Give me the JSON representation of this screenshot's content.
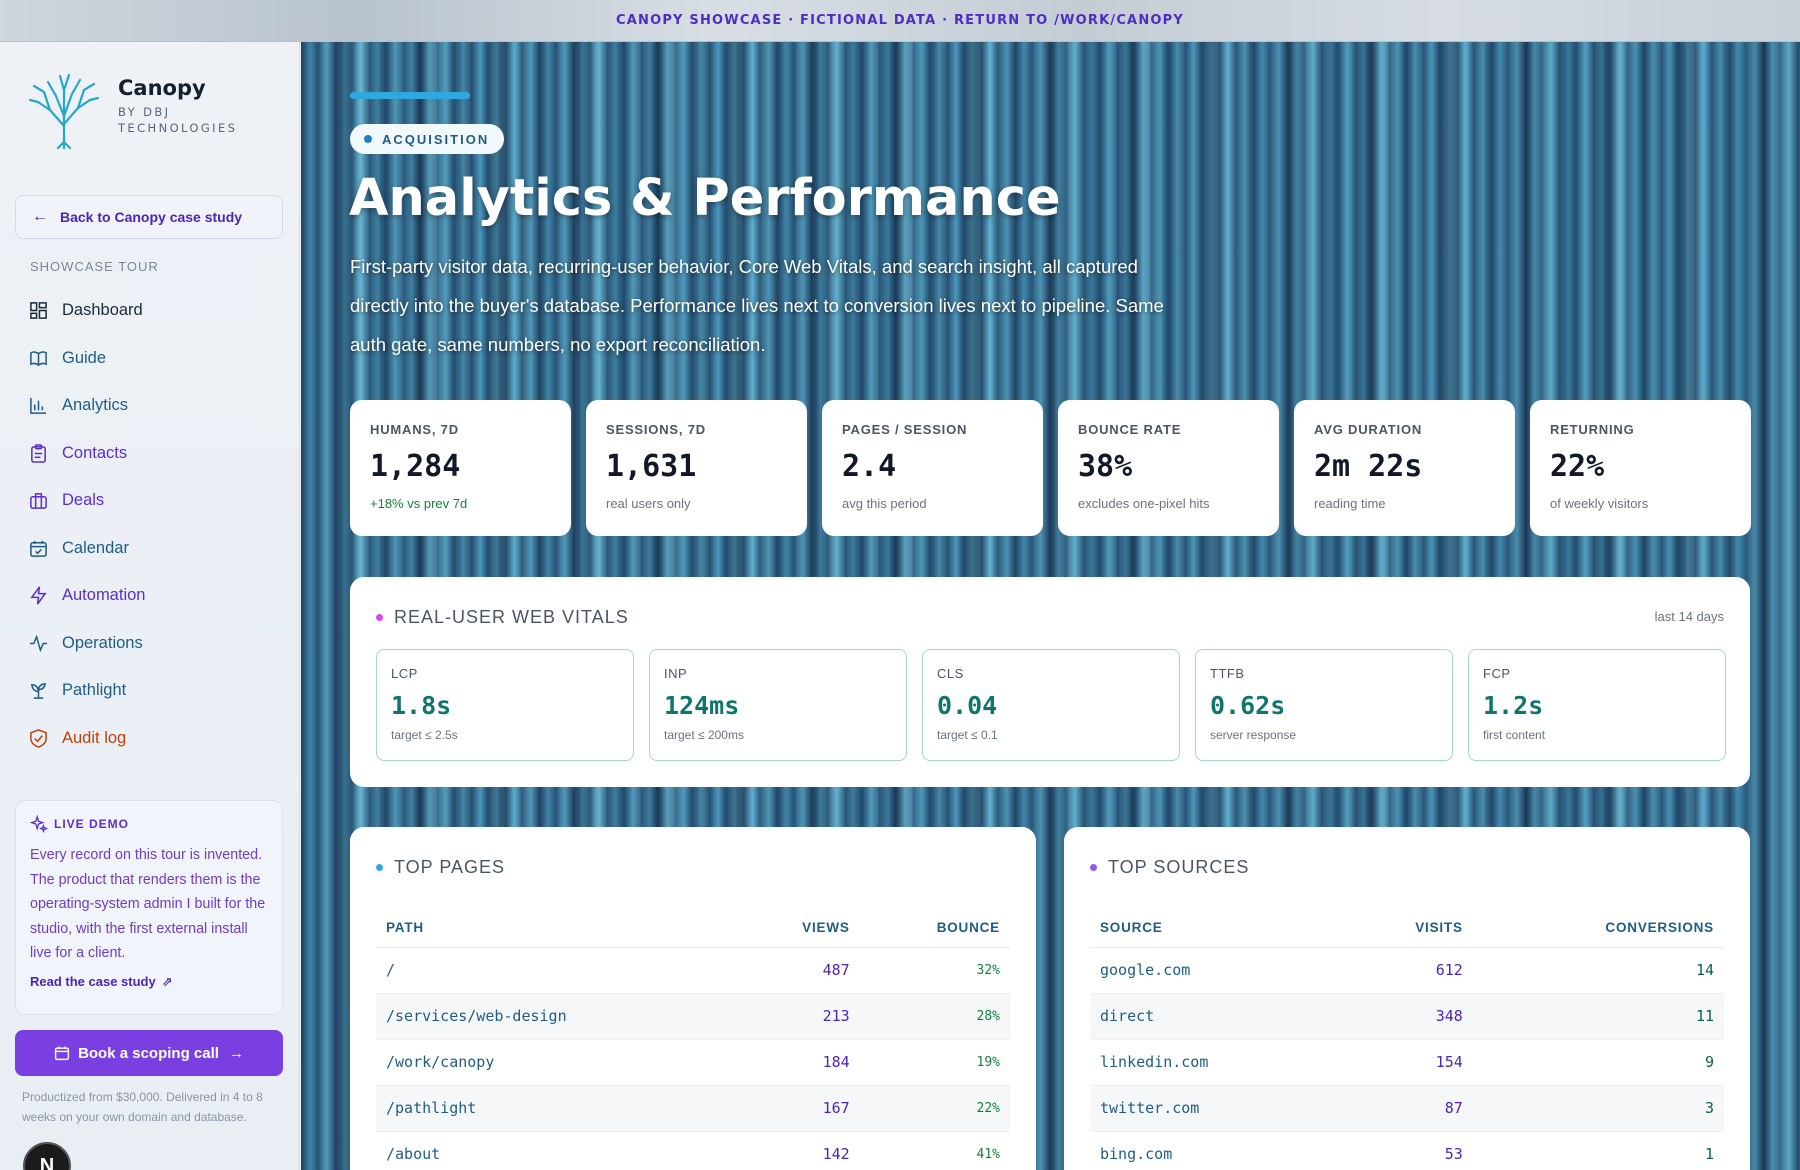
{
  "banner": {
    "text": "CANOPY SHOWCASE · FICTIONAL DATA · RETURN TO /WORK/CANOPY"
  },
  "brand": {
    "name": "Canopy",
    "sub": "BY DBJ TECHNOLOGIES"
  },
  "back": {
    "label": "Back to Canopy case study"
  },
  "tour": {
    "label": "SHOWCASE TOUR"
  },
  "nav": [
    {
      "label": "Dashboard",
      "icon": "dashboard-icon",
      "color": "#1f2a37"
    },
    {
      "label": "Guide",
      "icon": "book-icon",
      "color": "#1f5d86"
    },
    {
      "label": "Analytics",
      "icon": "bar-chart-icon",
      "color": "#1f5d86"
    },
    {
      "label": "Contacts",
      "icon": "clipboard-icon",
      "color": "#5b2fc9"
    },
    {
      "label": "Deals",
      "icon": "briefcase-icon",
      "color": "#5b2fc9"
    },
    {
      "label": "Calendar",
      "icon": "calendar-icon",
      "color": "#1f5d86"
    },
    {
      "label": "Automation",
      "icon": "bolt-icon",
      "color": "#5b2fc9"
    },
    {
      "label": "Operations",
      "icon": "pulse-icon",
      "color": "#1f5d86"
    },
    {
      "label": "Pathlight",
      "icon": "sprout-icon",
      "color": "#1f5d86"
    },
    {
      "label": "Audit log",
      "icon": "shield-icon",
      "color": "#c2410c"
    }
  ],
  "live": {
    "title": "LIVE DEMO",
    "body": "Every record on this tour is invented. The product that renders them is the operating-system admin I built for the studio, with the first external install live for a client.",
    "link": "Read the case study"
  },
  "book": {
    "label": "Book a scoping call"
  },
  "fine": {
    "text": "Productized from $30,000. Delivered in 4 to 8 weeks on your own domain and database."
  },
  "badge": {
    "letter": "N"
  },
  "hero": {
    "pill": "ACQUISITION",
    "title": "Analytics & Performance",
    "desc": "First-party visitor data, recurring-user behavior, Core Web Vitals, and search insight, all captured directly into the buyer's database. Performance lives next to conversion lives next to pipeline. Same auth gate, same numbers, no export reconciliation."
  },
  "kpis": [
    {
      "label": "HUMANS, 7D",
      "value": "1,284",
      "note": "+18% vs prev 7d",
      "up": true
    },
    {
      "label": "SESSIONS, 7D",
      "value": "1,631",
      "note": "real users only"
    },
    {
      "label": "PAGES / SESSION",
      "value": "2.4",
      "note": "avg this period"
    },
    {
      "label": "BOUNCE RATE",
      "value": "38%",
      "note": "excludes one-pixel hits"
    },
    {
      "label": "AVG DURATION",
      "value": "2m 22s",
      "note": "reading time"
    },
    {
      "label": "RETURNING",
      "value": "22%",
      "note": "of weekly visitors"
    }
  ],
  "vitals": {
    "title": "REAL-USER WEB VITALS",
    "range": "last 14 days",
    "items": [
      {
        "label": "LCP",
        "value": "1.8s",
        "note": "target ≤ 2.5s"
      },
      {
        "label": "INP",
        "value": "124ms",
        "note": "target ≤ 200ms"
      },
      {
        "label": "CLS",
        "value": "0.04",
        "note": "target ≤ 0.1"
      },
      {
        "label": "TTFB",
        "value": "0.62s",
        "note": "server response"
      },
      {
        "label": "FCP",
        "value": "1.2s",
        "note": "first content"
      }
    ]
  },
  "pages": {
    "title": "TOP PAGES",
    "cols": [
      "PATH",
      "VIEWS",
      "BOUNCE"
    ],
    "rows": [
      [
        "/",
        "487",
        "32%"
      ],
      [
        "/services/web-design",
        "213",
        "28%"
      ],
      [
        "/work/canopy",
        "184",
        "19%"
      ],
      [
        "/pathlight",
        "167",
        "22%"
      ],
      [
        "/about",
        "142",
        "41%"
      ]
    ]
  },
  "sources": {
    "title": "TOP SOURCES",
    "cols": [
      "SOURCE",
      "VISITS",
      "CONVERSIONS"
    ],
    "rows": [
      [
        "google.com",
        "612",
        "14"
      ],
      [
        "direct",
        "348",
        "11"
      ],
      [
        "linkedin.com",
        "154",
        "9"
      ],
      [
        "twitter.com",
        "87",
        "3"
      ],
      [
        "bing.com",
        "53",
        "1"
      ]
    ]
  },
  "colors": {
    "accent": "#7a3fe0",
    "brand_blue": "#1f5d86",
    "good": "#15803d",
    "vitals_dot": "#d946ef",
    "pages_dot": "#2fa8e0",
    "sources_dot": "#8b5cf6"
  }
}
